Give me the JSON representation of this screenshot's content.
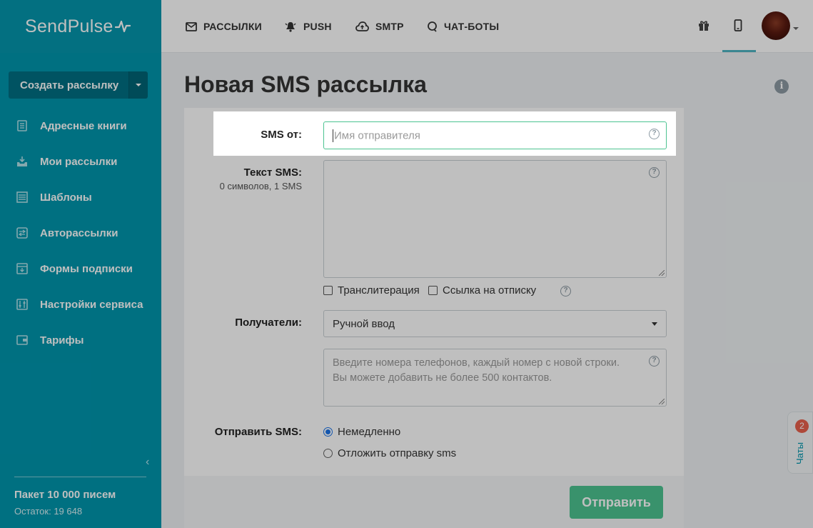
{
  "brand": {
    "name": "SendPulse"
  },
  "sidebar": {
    "create_button": "Создать рассылку",
    "items": [
      {
        "label": "Адресные книги",
        "icon": "address-book-icon"
      },
      {
        "label": "Мои рассылки",
        "icon": "inbox-icon"
      },
      {
        "label": "Шаблоны",
        "icon": "templates-icon"
      },
      {
        "label": "Авторассылки",
        "icon": "automation-icon"
      },
      {
        "label": "Формы подписки",
        "icon": "form-icon"
      },
      {
        "label": "Настройки сервиса",
        "icon": "sliders-icon"
      },
      {
        "label": "Тарифы",
        "icon": "wallet-icon"
      }
    ],
    "package_title": "Пакет 10 000 писем",
    "remaining": "Остаток: 19 648"
  },
  "topnav": {
    "items": [
      {
        "label": "РАССЫЛКИ",
        "icon": "mail-icon"
      },
      {
        "label": "PUSH",
        "icon": "bell-icon"
      },
      {
        "label": "SMTP",
        "icon": "cloud-icon"
      },
      {
        "label": "ЧАТ-БОТЫ",
        "icon": "chat-icon"
      }
    ]
  },
  "page": {
    "title": "Новая SMS рассылка",
    "sender_label": "SMS от:",
    "sender_placeholder": "Имя отправителя",
    "text_label": "Текст SMS:",
    "text_counter": "0 символов, 1 SMS",
    "transliteration": "Транслитерация",
    "unsubscribe_link": "Ссылка на отписку",
    "recipients_label": "Получатели:",
    "recipients_value": "Ручной ввод",
    "phones_placeholder_line1": "Введите номера телефонов, каждый номер с новой строки.",
    "phones_placeholder_line2": "Вы можете добавить не более 500 контактов.",
    "send_label": "Отправить SMS:",
    "send_now": "Немедленно",
    "send_later": "Отложить отправку sms",
    "submit": "Отправить"
  },
  "chats": {
    "label": "Чаты",
    "badge": "2"
  },
  "colors": {
    "sidebar": "#0096ad",
    "accent_green": "#4cc391",
    "badge": "#e8604c"
  }
}
